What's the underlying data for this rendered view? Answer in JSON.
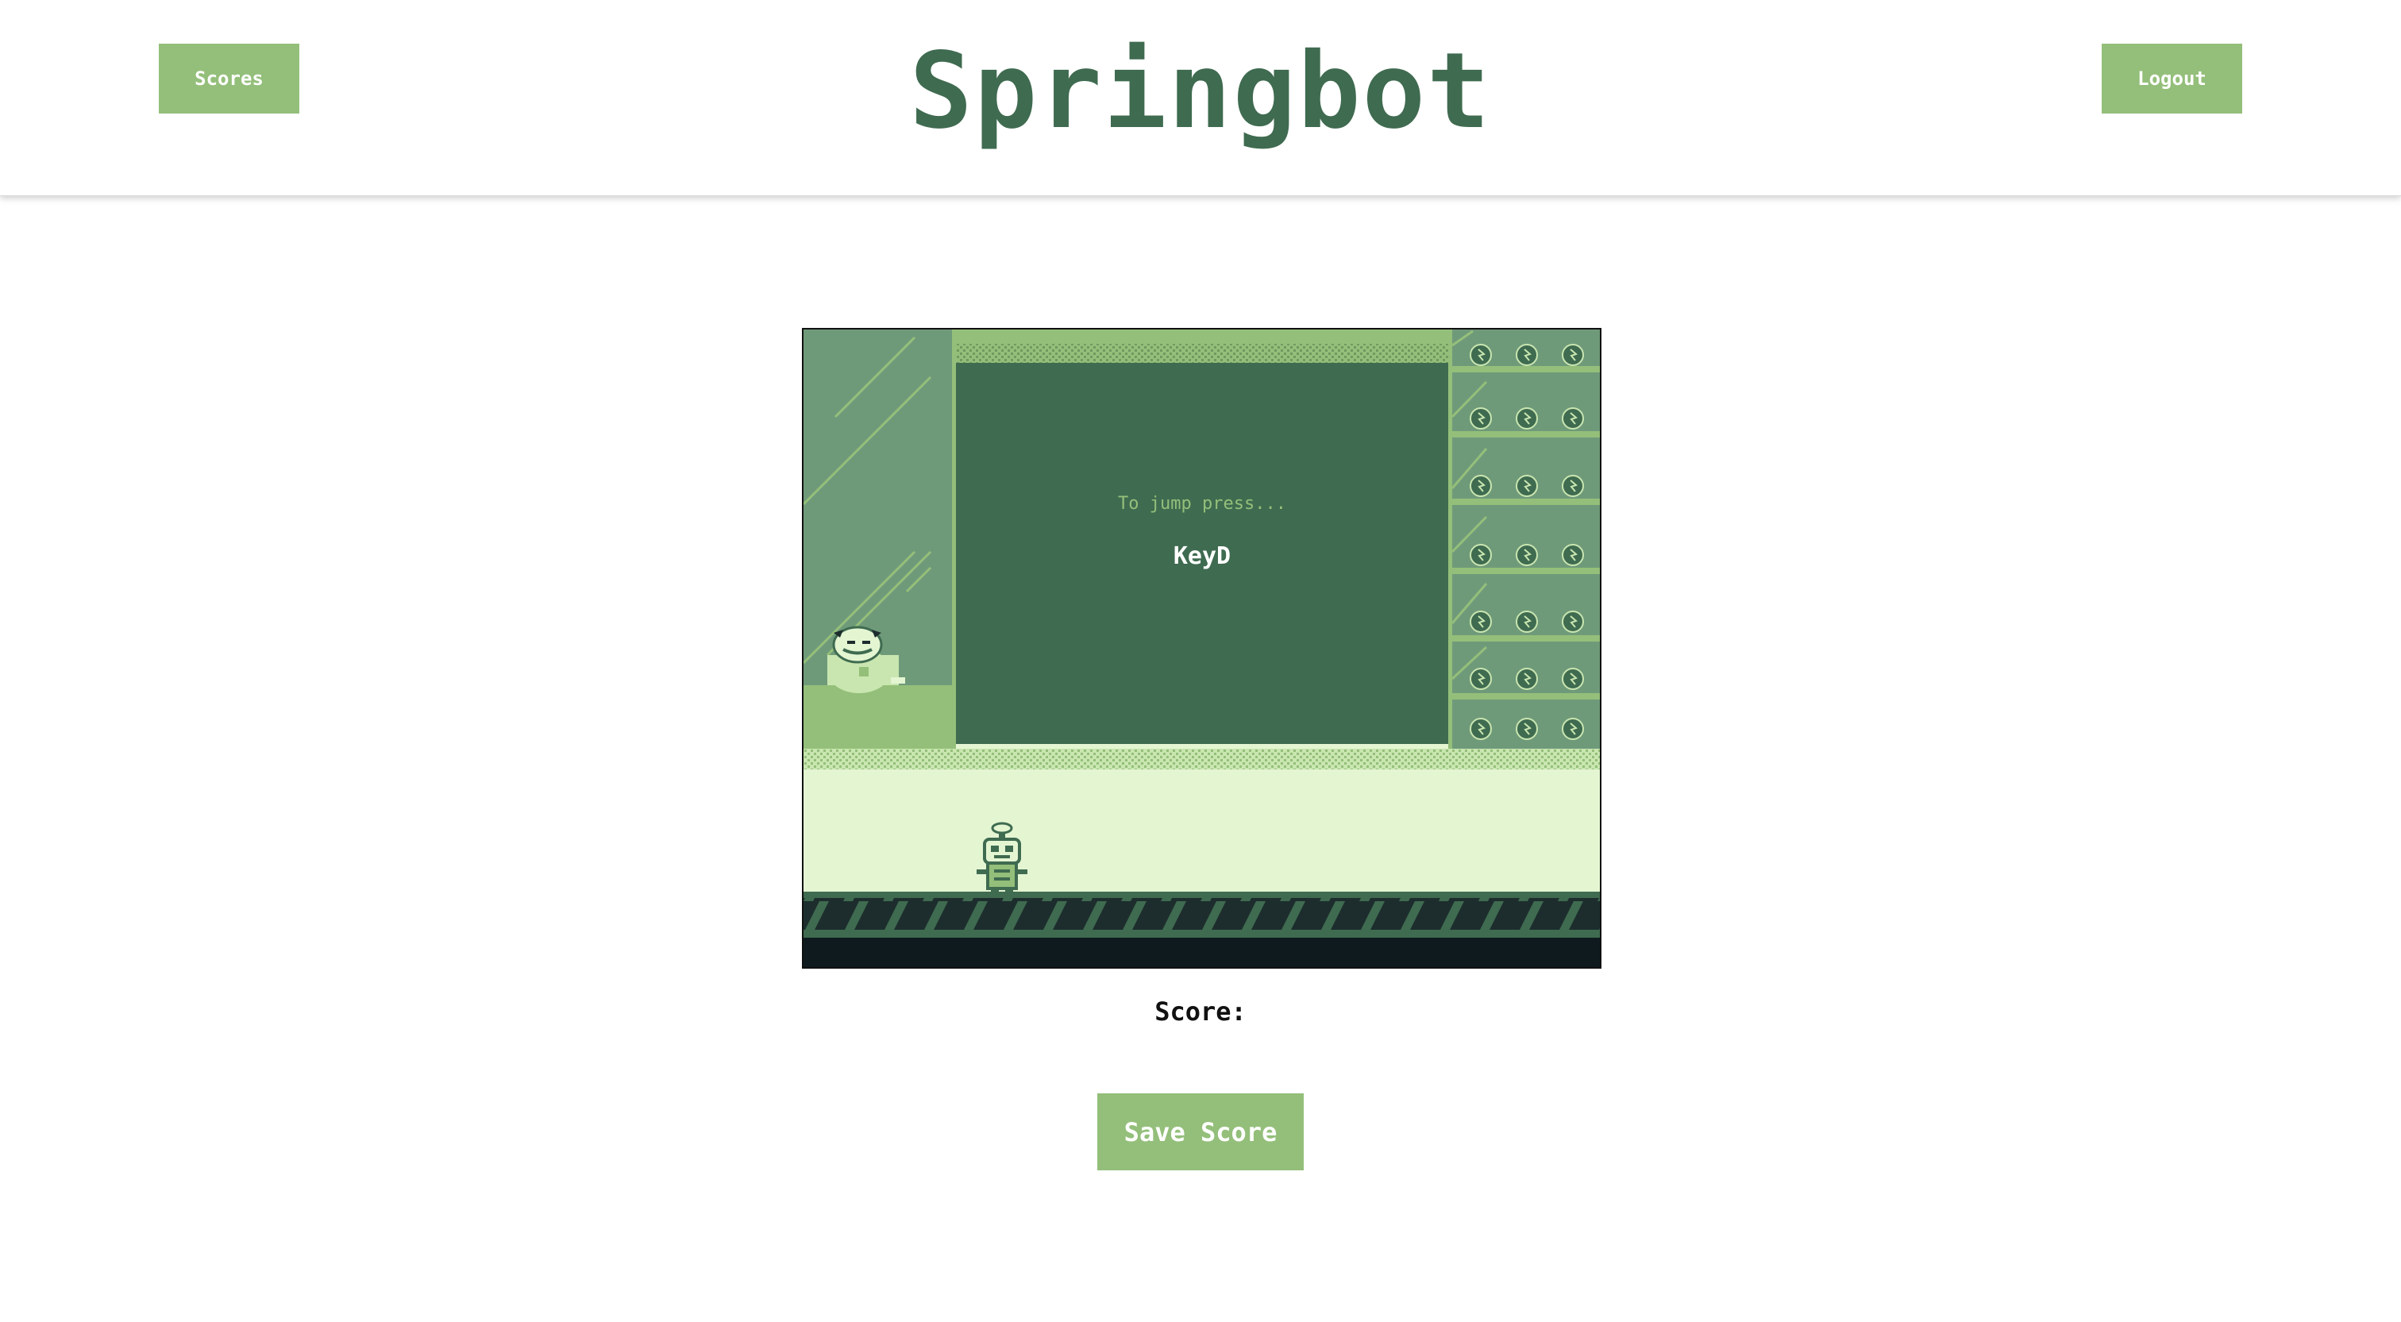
{
  "header": {
    "title": "Springbot",
    "scores_label": "Scores",
    "logout_label": "Logout"
  },
  "game": {
    "prompt": "To jump press...",
    "key": "KeyD"
  },
  "score": {
    "label": "Score:"
  },
  "actions": {
    "save_label": "Save Score"
  },
  "colors": {
    "accent": "#94bf7a",
    "title": "#3f6b50",
    "screen": "#3f6b50",
    "light": "#e4f5d2",
    "dark": "#0f1a1e"
  }
}
